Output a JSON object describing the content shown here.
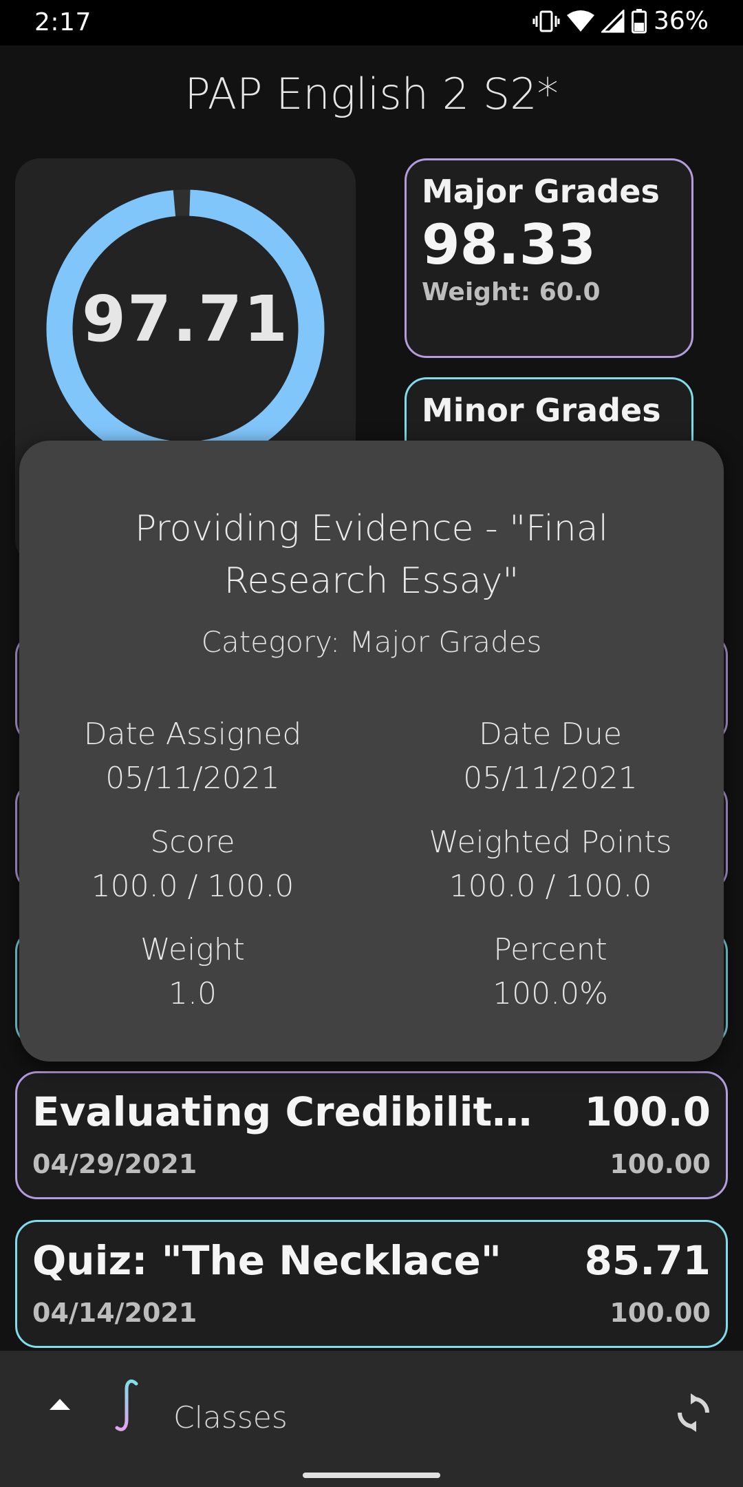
{
  "status_bar": {
    "time": "2:17",
    "battery": "36%"
  },
  "header": {
    "title": "PAP English 2 S2*"
  },
  "overall": {
    "grade": "97.71",
    "ring_fill_fraction": 0.98,
    "ring_color": "#81c6fb"
  },
  "categories": [
    {
      "name": "Major Grades",
      "value": "98.33",
      "weight": "Weight: 60.0",
      "color": "#b39ddb"
    },
    {
      "name": "Minor Grades",
      "color": "#80deea"
    }
  ],
  "dialog": {
    "title": "Providing Evidence - \"Final Research Essay\"",
    "category": "Category: Major Grades",
    "date_assigned_label": "Date Assigned",
    "date_assigned_value": "05/11/2021",
    "date_due_label": "Date Due",
    "date_due_value": "05/11/2021",
    "score_label": "Score",
    "score_value": "100.0 / 100.0",
    "weighted_points_label": "Weighted Points",
    "weighted_points_value": "100.0 / 100.0",
    "weight_label": "Weight",
    "weight_value": "1.0",
    "percent_label": "Percent",
    "percent_value": "100.0%"
  },
  "assignments": [
    {
      "name": "Evaluating Credibility …",
      "date": "04/29/2021",
      "score": "100.0",
      "total": "100.00",
      "color": "#b39ddb"
    },
    {
      "name": "Quiz: \"The Necklace\"",
      "date": "04/14/2021",
      "score": "85.71",
      "total": "100.00",
      "color": "#80deea"
    }
  ],
  "bottom_bar": {
    "label": "Classes",
    "icons": [
      "chevron-up-icon",
      "integral-logo-icon",
      "refresh-icon"
    ]
  }
}
